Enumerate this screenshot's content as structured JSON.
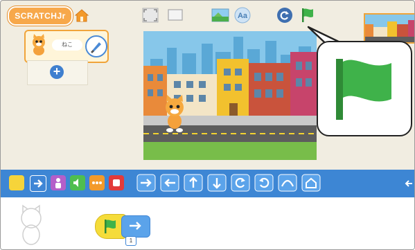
{
  "app": {
    "logo_text": "SCRATCHJr"
  },
  "sprite": {
    "name": "ねこ"
  },
  "block_params": {
    "hop_height": "1"
  },
  "colors": {
    "accent_orange": "#f0a43a",
    "palette_blue": "#3d86d4",
    "flag_green": "#3fb24a",
    "stage_sky": "#87c7ea",
    "road": "#5d5d5d"
  },
  "icons": {
    "top": [
      "home-icon",
      "full-screen-icon",
      "presentation-icon",
      "background-icon",
      "text-icon",
      "reset-icon",
      "green-flag-icon"
    ],
    "categories": [
      "triggering-category-icon",
      "motion-category-icon",
      "looks-category-icon",
      "sound-category-icon",
      "control-category-icon",
      "end-category-icon"
    ],
    "blocks": [
      "move-right-block",
      "move-left-block",
      "move-up-block",
      "move-down-block",
      "turn-right-block",
      "turn-left-block",
      "hop-block",
      "go-home-block"
    ]
  }
}
